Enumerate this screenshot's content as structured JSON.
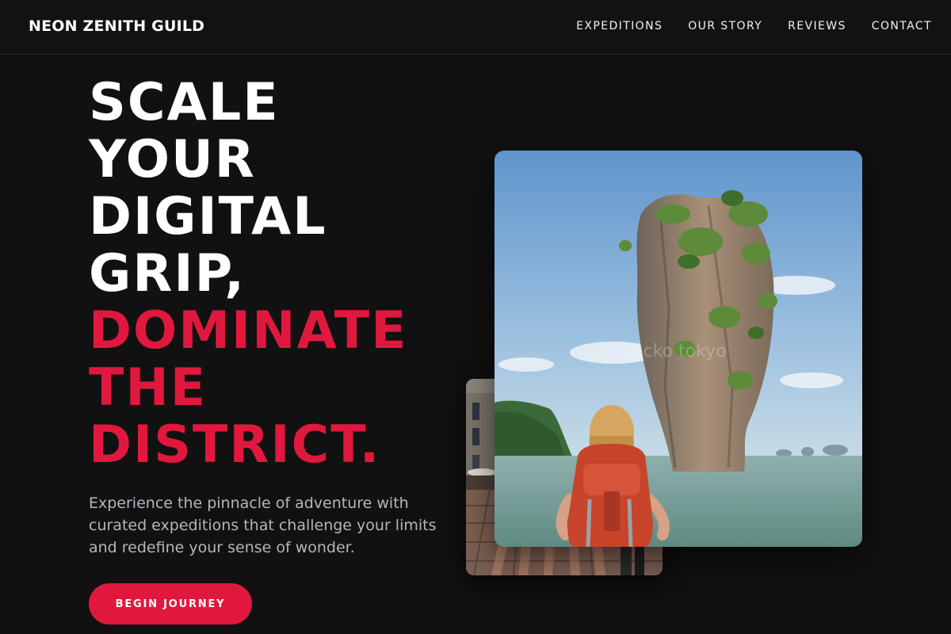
{
  "header": {
    "logo": "NEON ZENITH GUILD",
    "nav": [
      "EXPEDITIONS",
      "OUR STORY",
      "REVIEWS",
      "CONTACT"
    ]
  },
  "hero": {
    "headline_white": [
      "SCALE",
      "YOUR",
      "DIGITAL",
      "GRIP,"
    ],
    "headline_accent": [
      "DOMINATE",
      "THE",
      "DISTRICT."
    ],
    "tagline": "Experience the pinnacle of adventure with curated expeditions that challenge your limits and redefine your sense of wonder.",
    "cta_label": "BEGIN JOURNEY"
  },
  "images": {
    "front": "photo of a backpacker facing a tall limestone rock rising from the sea",
    "front_watermark": "gecko tokyo",
    "back": "photo of a cobblestone street with buildings and cafe umbrellas"
  },
  "colors": {
    "background": "#111111",
    "accent": "#e1183e",
    "text": "#ffffff",
    "muted_text": "#b4b6bd"
  }
}
